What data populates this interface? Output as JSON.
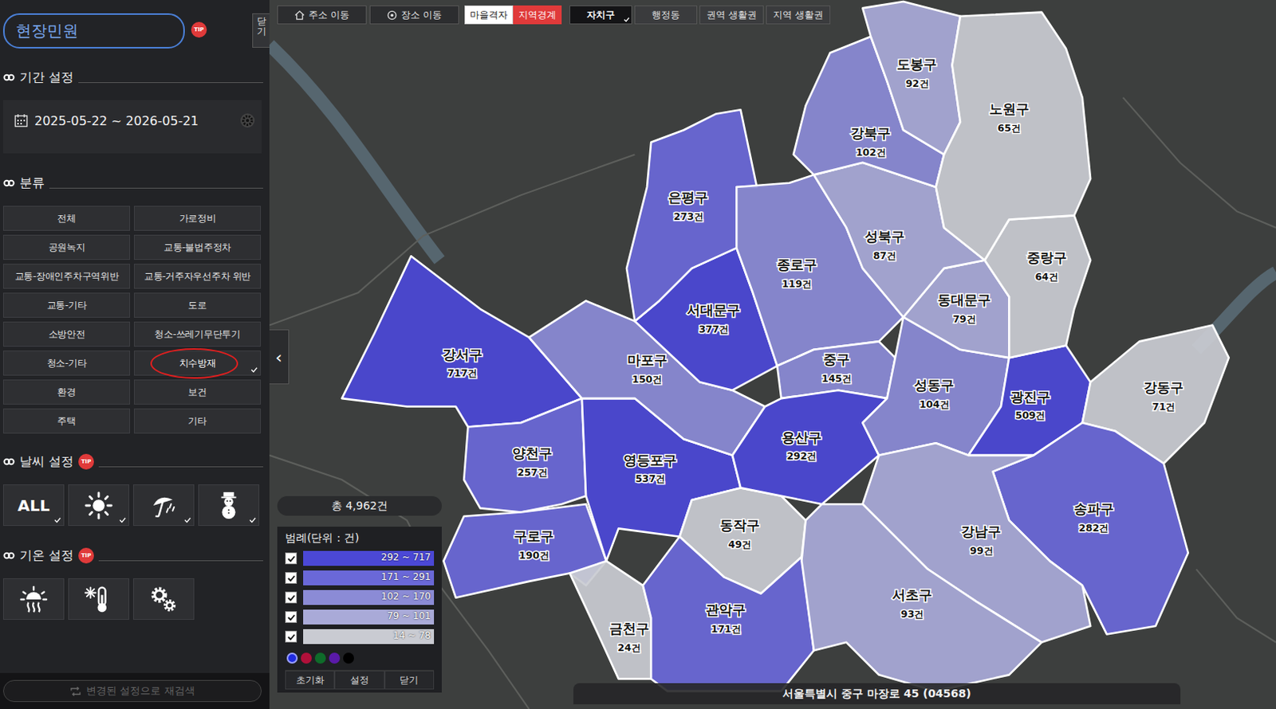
{
  "sidebar": {
    "title": "현장민원",
    "tip": "TIP",
    "close": "닫기",
    "period": {
      "heading": "기간 설정",
      "value": "2025-05-22 ~ 2026-05-21"
    },
    "category": {
      "heading": "분류",
      "items": [
        {
          "label": "전체",
          "selected": false
        },
        {
          "label": "가로정비",
          "selected": false
        },
        {
          "label": "공원녹지",
          "selected": false
        },
        {
          "label": "교통-불법주정차",
          "selected": false
        },
        {
          "label": "교통-장애인주차구역위반",
          "selected": false
        },
        {
          "label": "교통-거주자우선주차 위반",
          "selected": false
        },
        {
          "label": "교통-기타",
          "selected": false
        },
        {
          "label": "도로",
          "selected": false
        },
        {
          "label": "소방안전",
          "selected": false
        },
        {
          "label": "청소-쓰레기무단투기",
          "selected": false
        },
        {
          "label": "청소-기타",
          "selected": false
        },
        {
          "label": "치수방재",
          "selected": true
        },
        {
          "label": "환경",
          "selected": false
        },
        {
          "label": "보건",
          "selected": false
        },
        {
          "label": "주택",
          "selected": false
        },
        {
          "label": "기타",
          "selected": false
        }
      ]
    },
    "weather": {
      "heading": "날씨 설정",
      "tip": "TIP",
      "items": [
        {
          "kind": "text",
          "label": "ALL",
          "selected": true
        },
        {
          "kind": "sun",
          "selected": true
        },
        {
          "kind": "rain",
          "selected": true
        },
        {
          "kind": "snow",
          "selected": true
        }
      ]
    },
    "temperature": {
      "heading": "기온 설정",
      "tip": "TIP",
      "items": [
        {
          "kind": "hot",
          "selected": false
        },
        {
          "kind": "cold",
          "selected": false
        },
        {
          "kind": "settings",
          "selected": false
        }
      ]
    },
    "search": {
      "label": "변경된 설정으로 재검색",
      "disabled": true
    }
  },
  "toolbar": {
    "nav": [
      {
        "label": "주소 이동",
        "kind": "home"
      },
      {
        "label": "장소 이동",
        "kind": "place"
      }
    ],
    "layers": [
      {
        "label": "마을격자",
        "selected": false
      },
      {
        "label": "지역경계",
        "selected": true
      }
    ],
    "units": [
      {
        "label": "자치구",
        "selected": true
      },
      {
        "label": "행정동",
        "selected": false
      },
      {
        "label": "권역 생활권",
        "selected": false
      },
      {
        "label": "지역 생활권",
        "selected": false
      }
    ]
  },
  "map": {
    "collapse": "‹",
    "total": "총 4,962건",
    "address": "서울특별시 중구 마장로 45 (04568)",
    "districts": [
      {
        "name": "강서구",
        "count": "717건",
        "color": "#4b48d6"
      },
      {
        "name": "양천구",
        "count": "257건",
        "color": "#6a68d8"
      },
      {
        "name": "구로구",
        "count": "190건",
        "color": "#6a68d8"
      },
      {
        "name": "금천구",
        "count": "24건",
        "color": "#c9cbd2"
      },
      {
        "name": "영등포구",
        "count": "537건",
        "color": "#4b48d6"
      },
      {
        "name": "동작구",
        "count": "49건",
        "color": "#c9cbd2"
      },
      {
        "name": "관악구",
        "count": "171건",
        "color": "#6a68d8"
      },
      {
        "name": "마포구",
        "count": "150건",
        "color": "#8b8bd6"
      },
      {
        "name": "서대문구",
        "count": "377건",
        "color": "#4b48d6"
      },
      {
        "name": "은평구",
        "count": "273건",
        "color": "#6a68d8"
      },
      {
        "name": "종로구",
        "count": "119건",
        "color": "#8b8bd6"
      },
      {
        "name": "중구",
        "count": "145건",
        "color": "#8b8bd6"
      },
      {
        "name": "용산구",
        "count": "292건",
        "color": "#4b48d6"
      },
      {
        "name": "성동구",
        "count": "104건",
        "color": "#8b8bd6"
      },
      {
        "name": "광진구",
        "count": "509건",
        "color": "#4b48d6"
      },
      {
        "name": "동대문구",
        "count": "79건",
        "color": "#a9aad8"
      },
      {
        "name": "중랑구",
        "count": "64건",
        "color": "#c9cbd2"
      },
      {
        "name": "성북구",
        "count": "87건",
        "color": "#a9aad8"
      },
      {
        "name": "강북구",
        "count": "102건",
        "color": "#8b8bd6"
      },
      {
        "name": "도봉구",
        "count": "92건",
        "color": "#a9aad8"
      },
      {
        "name": "노원구",
        "count": "65건",
        "color": "#c9cbd2"
      },
      {
        "name": "강동구",
        "count": "71건",
        "color": "#c9cbd2"
      },
      {
        "name": "송파구",
        "count": "282건",
        "color": "#6a68d8"
      },
      {
        "name": "강남구",
        "count": "99건",
        "color": "#a9aad8"
      },
      {
        "name": "서초구",
        "count": "93건",
        "color": "#a9aad8"
      }
    ],
    "legend": {
      "title": "범례(단위 : 건)",
      "items": [
        {
          "range": "292 ~ 717",
          "checked": true,
          "color": "#4b48d6"
        },
        {
          "range": "171 ~ 291",
          "checked": true,
          "color": "#6a68d8"
        },
        {
          "range": "102 ~ 170",
          "checked": true,
          "color": "#8b8bd6"
        },
        {
          "range": "79 ~ 101",
          "checked": true,
          "color": "#a9aad8"
        },
        {
          "range": "14 ~ 78",
          "checked": true,
          "color": "#c9cbd2"
        }
      ],
      "palette": [
        {
          "color": "#1f2be0",
          "selected": true
        },
        {
          "color": "#b0103a",
          "selected": false
        },
        {
          "color": "#0f6b2a",
          "selected": false
        },
        {
          "color": "#5a1aa8",
          "selected": false
        },
        {
          "color": "#000000",
          "selected": false
        }
      ],
      "buttons": [
        "초기화",
        "설정",
        "닫기"
      ]
    }
  }
}
